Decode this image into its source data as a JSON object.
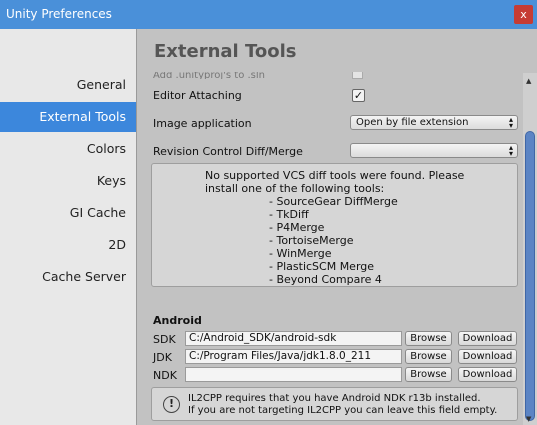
{
  "window": {
    "title": "Unity Preferences",
    "close_glyph": "x"
  },
  "sidebar": {
    "items": [
      {
        "label": "General",
        "active": false
      },
      {
        "label": "External Tools",
        "active": true
      },
      {
        "label": "Colors",
        "active": false
      },
      {
        "label": "Keys",
        "active": false
      },
      {
        "label": "GI Cache",
        "active": false
      },
      {
        "label": "2D",
        "active": false
      },
      {
        "label": "Cache Server",
        "active": false
      }
    ]
  },
  "main": {
    "heading": "External Tools",
    "clipped_row": "Add .unityproj's to .sln",
    "editor_attaching": {
      "label": "Editor Attaching",
      "checked": true,
      "check_glyph": "✓"
    },
    "image_application": {
      "label": "Image application",
      "value": "Open by file extension"
    },
    "revision_control": {
      "label": "Revision Control Diff/Merge",
      "value": ""
    },
    "vcs_info": {
      "lines": [
        "No supported VCS diff tools were found. Please",
        "install one of the following tools:",
        "- SourceGear DiffMerge",
        "- TkDiff",
        "- P4Merge",
        "- TortoiseMerge",
        "- WinMerge",
        "- PlasticSCM Merge",
        "- Beyond Compare 4"
      ]
    },
    "android": {
      "title": "Android",
      "rows": [
        {
          "label": "SDK",
          "value": "C:/Android_SDK/android-sdk",
          "browse": "Browse",
          "download": "Download"
        },
        {
          "label": "JDK",
          "value": "C:/Program Files/Java/jdk1.8.0_211",
          "browse": "Browse",
          "download": "Download"
        },
        {
          "label": "NDK",
          "value": "",
          "browse": "Browse",
          "download": "Download"
        }
      ],
      "help": {
        "icon": "!",
        "lines": [
          "IL2CPP requires that you have Android NDK r13b installed.",
          "If you are not targeting IL2CPP you can leave this field empty."
        ]
      }
    }
  },
  "colors": {
    "accent": "#3c87dc",
    "titlebar": "#4a90d9",
    "close": "#c63c34"
  }
}
